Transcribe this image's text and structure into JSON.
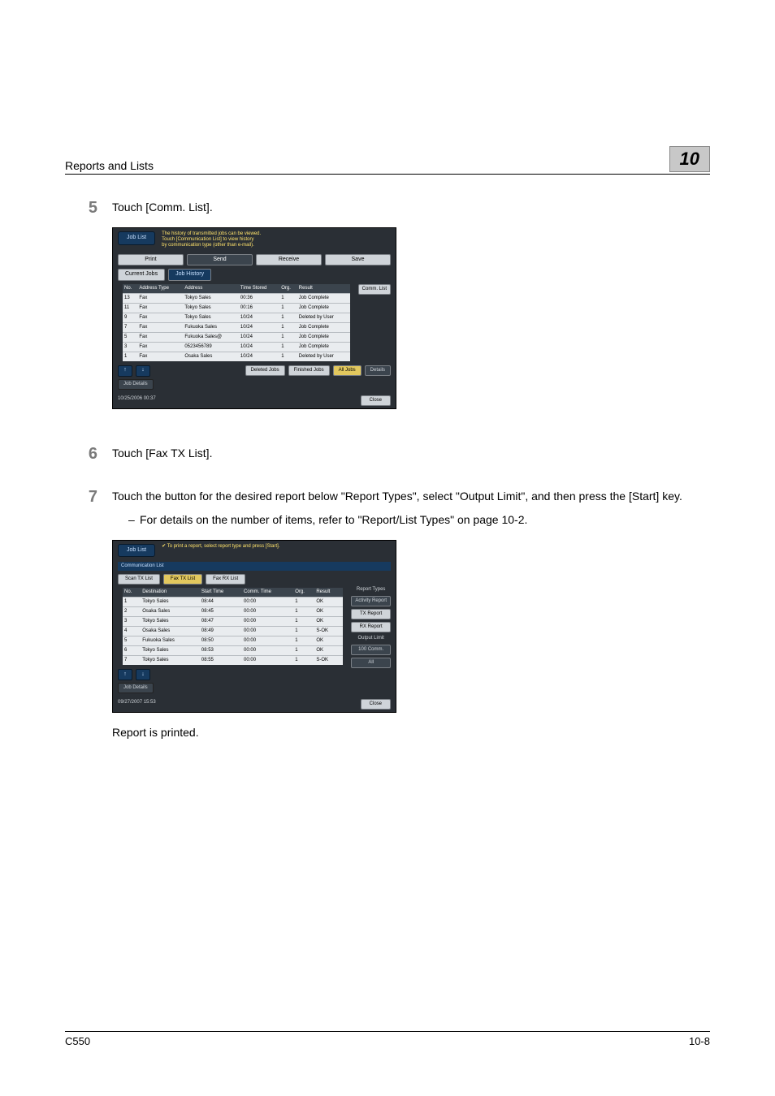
{
  "header": {
    "section": "Reports and Lists",
    "chapter": "10"
  },
  "step5": {
    "num": "5",
    "text": "Touch [Comm. List].",
    "scr": {
      "jobList": "Job List",
      "msg1": "The history of transmitted jobs can be viewed.",
      "msg2": "Touch [Communication List] to view history",
      "msg3": "by communication type (other than e-mail).",
      "tabs": [
        "Print",
        "Send",
        "Receive",
        "Save"
      ],
      "subtabs": [
        "Current Jobs",
        "Job History"
      ],
      "commBtn": "Comm. List",
      "cols": [
        "No.",
        "Address Type",
        "Address",
        "Time Stored",
        "Org.",
        "Result"
      ],
      "rows": [
        [
          "13",
          "Fax",
          "Tokyo Sales",
          "00:36",
          "1",
          "Job Complete"
        ],
        [
          "11",
          "Fax",
          "Tokyo Sales",
          "00:16",
          "1",
          "Job Complete"
        ],
        [
          "9",
          "Fax",
          "Tokyo Sales",
          "10/24",
          "1",
          "Deleted by User"
        ],
        [
          "7",
          "Fax",
          "Fukuoka Sales",
          "10/24",
          "1",
          "Job Complete"
        ],
        [
          "5",
          "Fax",
          "Fukuoka Sales@",
          "10/24",
          "1",
          "Job Complete"
        ],
        [
          "3",
          "Fax",
          "0523456789",
          "10/24",
          "1",
          "Job Complete"
        ],
        [
          "1",
          "Fax",
          "Osaka Sales",
          "10/24",
          "1",
          "Deleted by User"
        ]
      ],
      "fbtns": [
        "Deleted Jobs",
        "Finished Jobs",
        "All Jobs"
      ],
      "details": "Details",
      "jobDetails": "Job Details",
      "datetime": "10/25/2006   00:37",
      "close": "Close"
    }
  },
  "step6": {
    "num": "6",
    "text": "Touch [Fax TX List]."
  },
  "step7": {
    "num": "7",
    "text": "Touch the button for the desired report below \"Report Types\", select \"Output Limit\", and then press the [Start] key.",
    "sub": "For details on the number of items, refer to \"Report/List Types\" on page 10-2.",
    "scr": {
      "jobList": "Job List",
      "msg": "To print a report, select report type and press [Start].",
      "section": "Communication List",
      "subtabs": [
        "Scan TX List",
        "Fax TX List",
        "Fax RX List"
      ],
      "cols": [
        "No.",
        "Destination",
        "Start Time",
        "Comm. Time",
        "Org.",
        "Result"
      ],
      "rows": [
        [
          "1",
          "Tokyo Sales",
          "08:44",
          "00:00",
          "1",
          "OK"
        ],
        [
          "2",
          "Osaka Sales",
          "08:45",
          "00:00",
          "1",
          "OK"
        ],
        [
          "3",
          "Tokyo Sales",
          "08:47",
          "00:00",
          "1",
          "OK"
        ],
        [
          "4",
          "Osaka Sales",
          "08:49",
          "00:00",
          "1",
          "S-OK"
        ],
        [
          "5",
          "Fukuoka Sales",
          "08:50",
          "00:00",
          "1",
          "OK"
        ],
        [
          "6",
          "Tokyo Sales",
          "08:53",
          "00:00",
          "1",
          "OK"
        ],
        [
          "7",
          "Tokyo Sales",
          "08:55",
          "00:00",
          "1",
          "S-OK"
        ]
      ],
      "rtLabel": "Report Types",
      "rtBtns": [
        "Activity Report",
        "TX Report",
        "RX Report"
      ],
      "olLabel": "Output Limit",
      "olBtns": [
        "100 Comm.",
        "All"
      ],
      "jobDetails": "Job Details",
      "datetime": "09/27/2007   15:53",
      "close": "Close"
    }
  },
  "note": "Report is printed.",
  "footer": {
    "left": "C550",
    "right": "10-8"
  }
}
